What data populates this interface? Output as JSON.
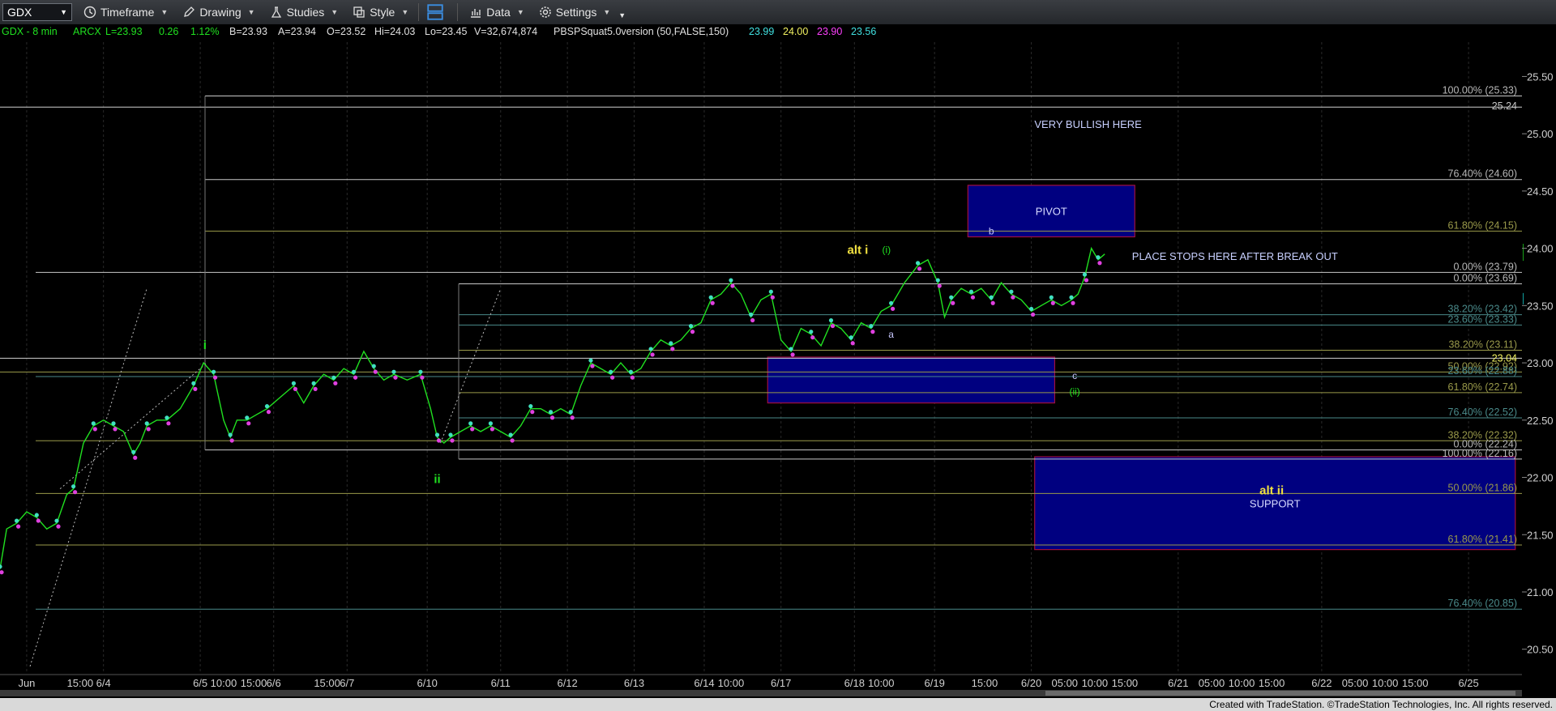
{
  "toolbar": {
    "symbol": "GDX",
    "timeframe": "Timeframe",
    "drawing": "Drawing",
    "studies": "Studies",
    "style": "Style",
    "data": "Data",
    "settings": "Settings"
  },
  "header": {
    "symbol_info": "GDX - 8 min",
    "exchange": "ARCX",
    "last": "L=23.93",
    "change": "0.26",
    "change_pct": "1.12%",
    "bid": "B=23.93",
    "ask": "A=23.94",
    "open": "O=23.52",
    "high": "Hi=24.03",
    "low": "Lo=23.45",
    "volume": "V=32,674,874",
    "study": "PBSPSquat5.0version (50,FALSE,150)",
    "study_values": [
      {
        "text": "23.99",
        "color": "#40e0e0"
      },
      {
        "text": "24.00",
        "color": "#f0f060"
      },
      {
        "text": "23.90",
        "color": "#ff40ff"
      },
      {
        "text": "23.56",
        "color": "#40e0e0"
      }
    ]
  },
  "footer": "Created with TradeStation. ©TradeStation Technologies, Inc. All rights reserved.",
  "chart_data": {
    "type": "line",
    "title": "GDX - 8 min",
    "ylim": [
      20.3,
      25.8
    ],
    "y_ticks": [
      "25.50",
      "25.00",
      "24.50",
      "24.00",
      "23.50",
      "23.00",
      "22.50",
      "22.00",
      "21.50",
      "21.00",
      "20.50"
    ],
    "x_tick_labels": [
      {
        "label": "Jun",
        "session": 0.4
      },
      {
        "label": "15:00",
        "session": 1.2
      },
      {
        "label": "6/4",
        "session": 1.55
      },
      {
        "label": "6/5",
        "session": 3.0
      },
      {
        "label": "10:00",
        "session": 3.35
      },
      {
        "label": "15:00",
        "session": 3.8
      },
      {
        "label": "6/6",
        "session": 4.1
      },
      {
        "label": "15:00",
        "session": 4.9
      },
      {
        "label": "6/7",
        "session": 5.2
      },
      {
        "label": "6/10",
        "session": 6.4
      },
      {
        "label": "6/11",
        "session": 7.5
      },
      {
        "label": "6/12",
        "session": 8.5
      },
      {
        "label": "6/13",
        "session": 9.5
      },
      {
        "label": "6/14",
        "session": 10.55
      },
      {
        "label": "10:00",
        "session": 10.95
      },
      {
        "label": "6/17",
        "session": 11.7
      },
      {
        "label": "6/18",
        "session": 12.8
      },
      {
        "label": "10:00",
        "session": 13.2
      },
      {
        "label": "6/19",
        "session": 14.0
      },
      {
        "label": "15:00",
        "session": 14.75
      },
      {
        "label": "6/20",
        "session": 15.45
      },
      {
        "label": "05:00",
        "session": 15.95
      },
      {
        "label": "10:00",
        "session": 16.4
      },
      {
        "label": "15:00",
        "session": 16.85
      },
      {
        "label": "6/21",
        "session": 17.65
      },
      {
        "label": "05:00",
        "session": 18.15
      },
      {
        "label": "10:00",
        "session": 18.6
      },
      {
        "label": "15:00",
        "session": 19.05
      },
      {
        "label": "6/22",
        "session": 19.8
      },
      {
        "label": "05:00",
        "session": 20.3
      },
      {
        "label": "10:00",
        "session": 20.75
      },
      {
        "label": "15:00",
        "session": 21.2
      },
      {
        "label": "6/25",
        "session": 22.0
      }
    ],
    "x_range": [
      0,
      22.8
    ],
    "series": [
      {
        "type": "price",
        "color": "#20e020",
        "points": [
          [
            0.0,
            21.2
          ],
          [
            0.1,
            21.55
          ],
          [
            0.25,
            21.6
          ],
          [
            0.4,
            21.7
          ],
          [
            0.55,
            21.65
          ],
          [
            0.7,
            21.55
          ],
          [
            0.85,
            21.6
          ],
          [
            1.0,
            21.85
          ],
          [
            1.1,
            21.9
          ],
          [
            1.25,
            22.3
          ],
          [
            1.4,
            22.45
          ],
          [
            1.55,
            22.5
          ],
          [
            1.7,
            22.45
          ],
          [
            1.85,
            22.4
          ],
          [
            2.0,
            22.2
          ],
          [
            2.1,
            22.3
          ],
          [
            2.2,
            22.45
          ],
          [
            2.35,
            22.5
          ],
          [
            2.5,
            22.5
          ],
          [
            2.7,
            22.6
          ],
          [
            2.9,
            22.8
          ],
          [
            3.05,
            23.0
          ],
          [
            3.2,
            22.9
          ],
          [
            3.35,
            22.5
          ],
          [
            3.45,
            22.35
          ],
          [
            3.55,
            22.5
          ],
          [
            3.7,
            22.5
          ],
          [
            3.85,
            22.55
          ],
          [
            4.0,
            22.6
          ],
          [
            4.2,
            22.7
          ],
          [
            4.4,
            22.8
          ],
          [
            4.55,
            22.65
          ],
          [
            4.7,
            22.8
          ],
          [
            4.85,
            22.9
          ],
          [
            5.0,
            22.85
          ],
          [
            5.15,
            22.95
          ],
          [
            5.3,
            22.9
          ],
          [
            5.45,
            23.1
          ],
          [
            5.6,
            22.95
          ],
          [
            5.75,
            22.85
          ],
          [
            5.9,
            22.9
          ],
          [
            6.1,
            22.85
          ],
          [
            6.3,
            22.9
          ],
          [
            6.45,
            22.6
          ],
          [
            6.55,
            22.35
          ],
          [
            6.65,
            22.3
          ],
          [
            6.75,
            22.35
          ],
          [
            6.9,
            22.4
          ],
          [
            7.05,
            22.45
          ],
          [
            7.2,
            22.4
          ],
          [
            7.35,
            22.45
          ],
          [
            7.5,
            22.4
          ],
          [
            7.65,
            22.35
          ],
          [
            7.8,
            22.45
          ],
          [
            7.95,
            22.6
          ],
          [
            8.1,
            22.6
          ],
          [
            8.25,
            22.55
          ],
          [
            8.4,
            22.6
          ],
          [
            8.55,
            22.55
          ],
          [
            8.7,
            22.8
          ],
          [
            8.85,
            23.0
          ],
          [
            9.0,
            22.95
          ],
          [
            9.15,
            22.9
          ],
          [
            9.3,
            23.0
          ],
          [
            9.45,
            22.9
          ],
          [
            9.6,
            22.95
          ],
          [
            9.75,
            23.1
          ],
          [
            9.9,
            23.2
          ],
          [
            10.05,
            23.15
          ],
          [
            10.2,
            23.2
          ],
          [
            10.35,
            23.3
          ],
          [
            10.5,
            23.35
          ],
          [
            10.65,
            23.55
          ],
          [
            10.8,
            23.6
          ],
          [
            10.95,
            23.7
          ],
          [
            11.1,
            23.6
          ],
          [
            11.25,
            23.4
          ],
          [
            11.4,
            23.55
          ],
          [
            11.55,
            23.6
          ],
          [
            11.7,
            23.2
          ],
          [
            11.85,
            23.1
          ],
          [
            12.0,
            23.3
          ],
          [
            12.15,
            23.25
          ],
          [
            12.3,
            23.15
          ],
          [
            12.45,
            23.35
          ],
          [
            12.6,
            23.3
          ],
          [
            12.75,
            23.2
          ],
          [
            12.9,
            23.35
          ],
          [
            13.05,
            23.3
          ],
          [
            13.2,
            23.45
          ],
          [
            13.35,
            23.5
          ],
          [
            13.55,
            23.7
          ],
          [
            13.75,
            23.85
          ],
          [
            13.9,
            23.9
          ],
          [
            14.05,
            23.7
          ],
          [
            14.15,
            23.4
          ],
          [
            14.25,
            23.55
          ],
          [
            14.4,
            23.65
          ],
          [
            14.55,
            23.6
          ],
          [
            14.7,
            23.65
          ],
          [
            14.85,
            23.55
          ],
          [
            15.0,
            23.7
          ],
          [
            15.15,
            23.6
          ],
          [
            15.3,
            23.55
          ],
          [
            15.45,
            23.45
          ],
          [
            15.6,
            23.5
          ],
          [
            15.75,
            23.55
          ],
          [
            15.9,
            23.5
          ],
          [
            16.05,
            23.55
          ],
          [
            16.15,
            23.6
          ],
          [
            16.25,
            23.75
          ],
          [
            16.35,
            24.0
          ],
          [
            16.45,
            23.9
          ],
          [
            16.55,
            23.95
          ]
        ]
      }
    ],
    "fib_levels": [
      {
        "label": "100.00% (25.33)",
        "value": 25.33,
        "color": "#c8c8c8"
      },
      {
        "label": "76.40% (24.60)",
        "value": 24.6,
        "color": "#c8c8c8"
      },
      {
        "label": "61.80% (24.15)",
        "value": 24.15,
        "color": "#9a9a4a"
      },
      {
        "label": "0.00% (23.79)",
        "value": 23.79,
        "color": "#c8c8c8"
      },
      {
        "label": "0.00% (23.69)",
        "value": 23.69,
        "color": "#c8c8c8"
      },
      {
        "label": "38.20% (23.42)",
        "value": 23.42,
        "color": "#4a8a8a"
      },
      {
        "label": "23.60% (23.33)",
        "value": 23.33,
        "color": "#4a8a8a"
      },
      {
        "label": "38.20% (23.11)",
        "value": 23.11,
        "color": "#9a9a4a"
      },
      {
        "label": "50.00% (22.92)",
        "value": 22.92,
        "color": "#9a9a4a"
      },
      {
        "label": "23.60% (22.88)",
        "value": 22.88,
        "color": "#4a8a8a"
      },
      {
        "label": "61.80% (22.74)",
        "value": 22.74,
        "color": "#9a9a4a"
      },
      {
        "label": "76.40% (22.52)",
        "value": 22.52,
        "color": "#4a8a8a"
      },
      {
        "label": "38.20% (22.32)",
        "value": 22.32,
        "color": "#9a9a4a"
      },
      {
        "label": "0.00% (22.24)",
        "value": 22.24,
        "color": "#c8c8c8"
      },
      {
        "label": "100.00% (22.16)",
        "value": 22.16,
        "color": "#c8c8c8"
      },
      {
        "label": "50.00% (21.86)",
        "value": 21.86,
        "color": "#9a9a4a"
      },
      {
        "label": "61.80% (21.41)",
        "value": 21.41,
        "color": "#9a9a4a"
      },
      {
        "label": "76.40% (20.85)",
        "value": 20.85,
        "color": "#4a8a8a"
      }
    ],
    "price_markers": [
      {
        "text": "25.24",
        "value": 25.24,
        "color": "#c8c8c8"
      },
      {
        "text": "23.04",
        "value": 23.04,
        "color": "#f0f060"
      }
    ],
    "last_price_tags": [
      {
        "text": "23.99",
        "value": 23.99,
        "color": "#18a018"
      },
      {
        "text": "23.94",
        "value": 23.94,
        "color": "#18a018"
      },
      {
        "text": "23.56",
        "value": 23.56,
        "color": "#10a0a0"
      }
    ],
    "zones": [
      {
        "label": "PIVOT",
        "session_start": 14.5,
        "session_end": 17.0,
        "top": 24.55,
        "bottom": 24.1
      },
      {
        "label": "",
        "session_start": 11.5,
        "session_end": 15.8,
        "top": 23.05,
        "bottom": 22.65
      },
      {
        "label": "SUPPORT",
        "session_start": 15.5,
        "session_end": 22.7,
        "top": 22.18,
        "bottom": 21.37
      }
    ],
    "annotations": [
      {
        "text": "VERY BULLISH HERE",
        "session": 16.3,
        "value": 25.05,
        "color": "#c8d0ff",
        "size": 13
      },
      {
        "text": "PLACE STOPS HERE AFTER BREAK OUT",
        "session": 18.5,
        "value": 23.9,
        "color": "#c8d0ff",
        "size": 13
      },
      {
        "text": "alt i",
        "session": 12.85,
        "value": 23.95,
        "color": "#f0e040",
        "size": 15,
        "bold": true
      },
      {
        "text": "(i)",
        "session": 13.28,
        "value": 23.96,
        "color": "#20e020",
        "size": 12
      },
      {
        "text": "b",
        "session": 14.85,
        "value": 24.12,
        "color": "#c8c8ff",
        "size": 12
      },
      {
        "text": "a",
        "session": 13.35,
        "value": 23.22,
        "color": "#c8c8ff",
        "size": 12
      },
      {
        "text": "c",
        "session": 16.1,
        "value": 22.86,
        "color": "#c8c8ff",
        "size": 12
      },
      {
        "text": "(ii)",
        "session": 16.1,
        "value": 22.72,
        "color": "#20e020",
        "size": 12
      },
      {
        "text": "i",
        "session": 3.07,
        "value": 23.12,
        "color": "#20e020",
        "size": 15,
        "bold": true
      },
      {
        "text": "ii",
        "session": 6.55,
        "value": 21.95,
        "color": "#20e020",
        "size": 15,
        "bold": true
      },
      {
        "text": "alt ii",
        "session": 19.05,
        "value": 21.85,
        "color": "#f0e040",
        "size": 15,
        "bold": true
      }
    ]
  }
}
